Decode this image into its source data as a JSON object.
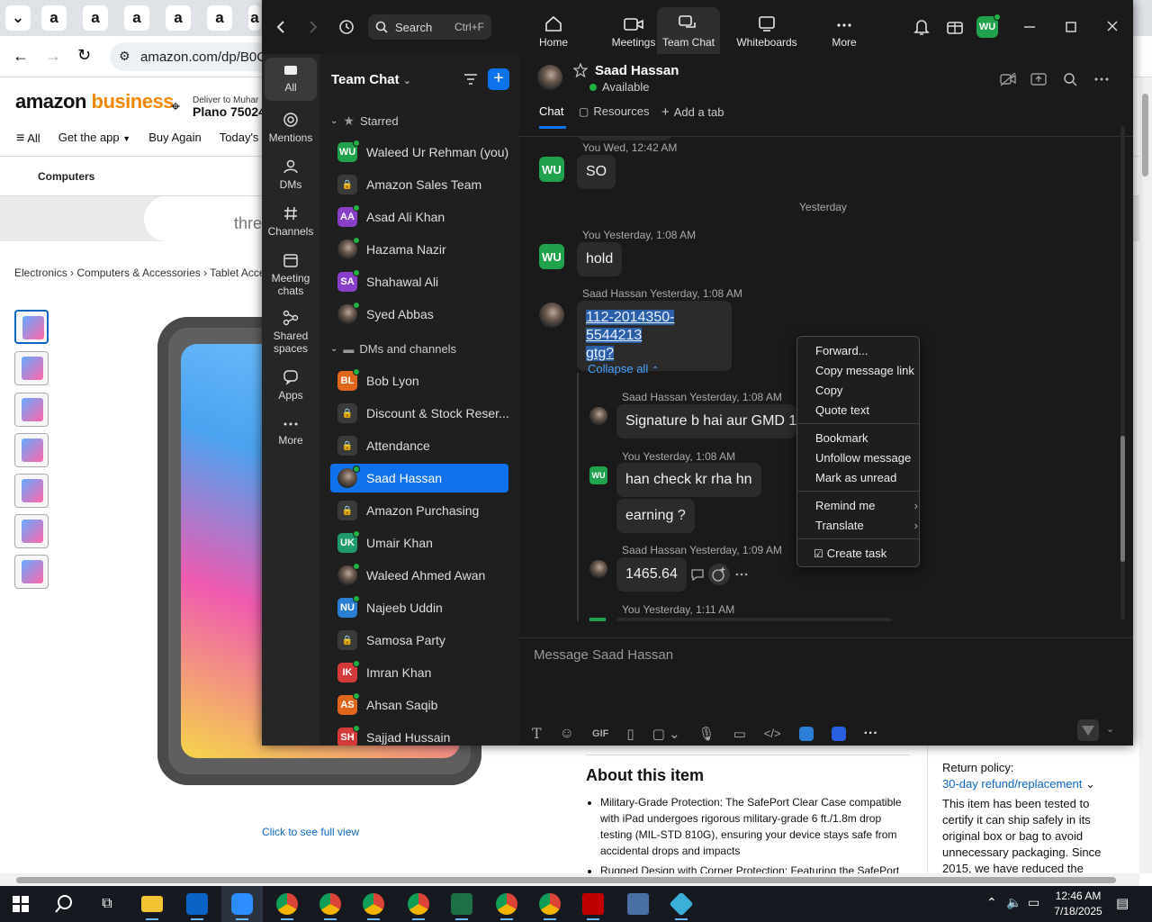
{
  "browser": {
    "tab_glyph": "a",
    "url": "amazon.com/dp/B0C",
    "logo_left": "amazon",
    "logo_right": "business",
    "deliver_to": "Deliver to Muhar",
    "deliver_zip": "Plano 75024",
    "nav": {
      "all": "All",
      "get_app": "Get the app",
      "buy_again": "Buy Again",
      "todays_deals": "Today's Dea"
    },
    "subnav_computers": "Computers",
    "banner_text": "thre",
    "breadcrumb": "Electronics › Computers & Accessories › Tablet Accesso",
    "full_view": "Click to see full view",
    "about_title": "About this item",
    "about_items": [
      "Military-Grade Protection: The SafePort Clear Case compatible with iPad undergoes rigorous military-grade 6 ft./1.8m drop testing (MIL-STD 810G), ensuring your device stays safe from accidental drops and impacts",
      "Rugged Design with Corner Protection: Featuring the SafePort"
    ],
    "return_label": "Return policy:",
    "return_link": "30-day refund/replacement",
    "return_text": "This item has been tested to certify it can ship safely in its original box or bag to avoid unnecessary packaging. Since 2015, we have reduced the"
  },
  "zoom": {
    "search_label": "Search",
    "search_shortcut": "Ctrl+F",
    "top_tabs": {
      "home": "Home",
      "meetings": "Meetings",
      "team_chat": "Team Chat",
      "whiteboards": "Whiteboards",
      "more": "More"
    },
    "user_initials": "WU",
    "rail": {
      "all": "All",
      "mentions": "Mentions",
      "dms": "DMs",
      "channels": "Channels",
      "meeting_chats": "Meeting chats",
      "shared_spaces": "Shared spaces",
      "apps": "Apps",
      "more": "More"
    },
    "sidebar": {
      "title": "Team Chat",
      "starred": "Starred",
      "dms_channels": "DMs and channels",
      "starred_items": [
        {
          "initials": "WU",
          "name": "Waleed Ur Rehman (you)",
          "color": "#1fa24b"
        },
        {
          "initials": "",
          "name": "Amazon Sales Team",
          "color": "#3a3a3a"
        },
        {
          "initials": "AA",
          "name": "Asad Ali Khan",
          "color": "#8a3fc8"
        },
        {
          "initials": "",
          "name": "Hazama Nazir",
          "color": "#6b2a3a"
        },
        {
          "initials": "SA",
          "name": "Shahawal Ali",
          "color": "#8a3fc8"
        },
        {
          "initials": "",
          "name": "Syed Abbas",
          "color": "#444"
        }
      ],
      "dm_items": [
        {
          "initials": "BL",
          "name": "Bob Lyon",
          "color": "#e0661b"
        },
        {
          "initials": "",
          "name": "Discount & Stock Reser...",
          "color": "#3a3a3a"
        },
        {
          "initials": "",
          "name": "Attendance",
          "color": "#3a3a3a"
        },
        {
          "initials": "",
          "name": "Saad Hassan",
          "color": "#555"
        },
        {
          "initials": "",
          "name": "Amazon Purchasing",
          "color": "#3a3a3a"
        },
        {
          "initials": "UK",
          "name": "Umair Khan",
          "color": "#1f9a6a"
        },
        {
          "initials": "",
          "name": "Waleed Ahmed Awan",
          "color": "#555"
        },
        {
          "initials": "NU",
          "name": "Najeeb Uddin",
          "color": "#2a7fd4"
        },
        {
          "initials": "",
          "name": "Samosa Party",
          "color": "#3a3a3a"
        },
        {
          "initials": "IK",
          "name": "Imran Khan",
          "color": "#d43a3a"
        },
        {
          "initials": "AS",
          "name": "Ahsan Saqib",
          "color": "#e0661b"
        },
        {
          "initials": "SH",
          "name": "Sajjad Hussain",
          "color": "#d43a3a"
        }
      ]
    },
    "chat": {
      "contact_name": "Saad Hassan",
      "contact_status": "Available",
      "tabs": {
        "chat": "Chat",
        "resources": "Resources",
        "add_tab": "Add a tab"
      },
      "messages": {
        "m1_meta": "You Wed, 12:42 AM",
        "m1_text": "SO",
        "divider": "Yesterday",
        "m2_meta": "You Yesterday, 1:08 AM",
        "m2_text": "hold",
        "m3_meta": "Saad Hassan Yesterday, 1:08 AM",
        "m3_line1": "112-2014350-5544213",
        "m3_line2": "gtg?",
        "collapse": "Collapse all",
        "r1_meta": "Saad Hassan Yesterday, 1:08 AM",
        "r1_text": "Signature b hai aur GMD 1 a",
        "r2_meta": "You Yesterday, 1:08 AM",
        "r2_text": "han check kr rha hn",
        "r3_text": "earning ?",
        "r4_meta": "Saad Hassan Yesterday, 1:09 AM",
        "r4_text": "1465.64",
        "r5_meta": "You Yesterday, 1:11 AM"
      },
      "composer_placeholder": "Message Saad Hassan",
      "gif_label": "GIF"
    },
    "context_menu": {
      "forward": "Forward...",
      "copy_link": "Copy message link",
      "copy": "Copy",
      "quote": "Quote text",
      "bookmark": "Bookmark",
      "unfollow": "Unfollow message",
      "mark_unread": "Mark as unread",
      "remind": "Remind me",
      "translate": "Translate",
      "create_task": "Create task"
    }
  },
  "taskbar": {
    "time": "12:46 AM",
    "date": "7/18/2025"
  }
}
